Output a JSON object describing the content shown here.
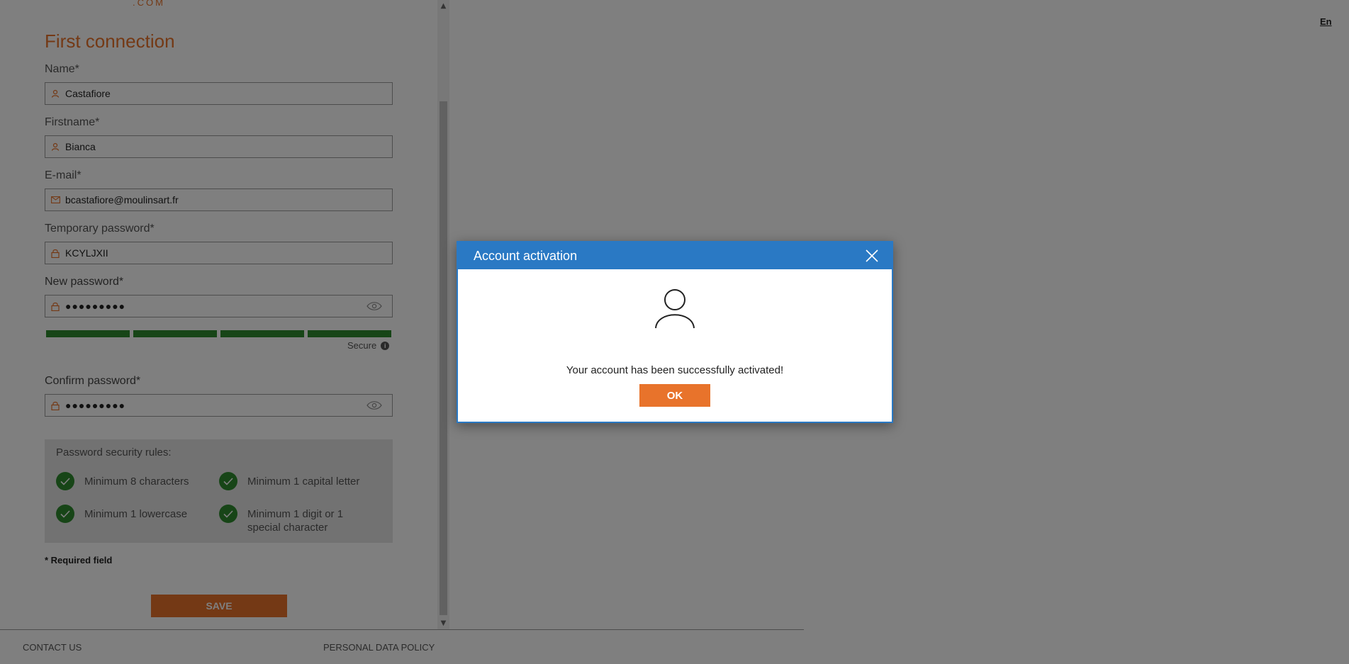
{
  "brand": {
    "logo_fragment": ".COM"
  },
  "language": {
    "current": "En"
  },
  "form": {
    "title": "First connection",
    "name": {
      "label": "Name*",
      "value": "Castafiore",
      "icon": "user-icon"
    },
    "firstname": {
      "label": "Firstname*",
      "value": "Bianca",
      "icon": "user-icon"
    },
    "email": {
      "label": "E-mail*",
      "value": "bcastafiore@moulinsart.fr",
      "icon": "envelope-icon"
    },
    "temp_password": {
      "label": "Temporary password*",
      "value": "KCYLJXII",
      "icon": "lock-icon"
    },
    "new_password": {
      "label": "New password*",
      "value": "●●●●●●●●●",
      "icon": "lock-icon",
      "toggle_icon": "eye-icon"
    },
    "strength": {
      "label": "Secure",
      "level": "4/4"
    },
    "confirm_password": {
      "label": "Confirm password*",
      "value": "●●●●●●●●●",
      "icon": "lock-icon",
      "toggle_icon": "eye-icon"
    },
    "rules": {
      "title": "Password security rules:",
      "items": [
        "Minimum 8 characters",
        "Minimum 1 capital letter",
        "Minimum 1 lowercase",
        "Minimum 1 digit or 1 special character"
      ]
    },
    "required_note": "* Required field",
    "save_label": "SAVE"
  },
  "footer": {
    "contact": "CONTACT US",
    "policy": "PERSONAL DATA POLICY"
  },
  "dialog": {
    "title": "Account activation",
    "message": "Your account has been successfully activated!",
    "ok_label": "OK"
  },
  "colors": {
    "accent": "#e8732b",
    "dialog_header": "#2a79c4",
    "success": "#2e8b2e"
  }
}
